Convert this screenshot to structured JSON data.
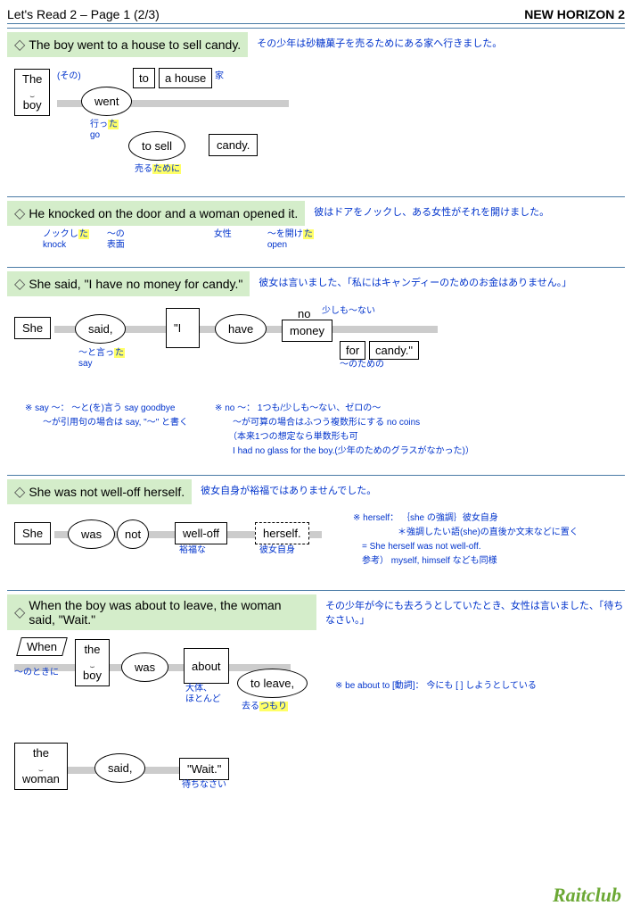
{
  "header": {
    "left": "Let's Read 2 – Page 1 (2/3)",
    "right": "NEW HORIZON 2"
  },
  "s1": {
    "en": "The boy went to a house to sell candy.",
    "jp": "その少年は砂糖菓子を売るためにある家へ行きました。",
    "w_the": "The",
    "w_boy": "boy",
    "w_went": "went",
    "w_to": "to",
    "w_house": "a house",
    "w_sell": "to sell",
    "w_candy": "candy.",
    "a_sono": "(その)",
    "a_ie": "家",
    "a_itta": "行った",
    "a_go": "go",
    "a_uru": "売るために"
  },
  "s2": {
    "en": "He knocked on the door and a woman opened it.",
    "jp": "彼はドアをノックし、ある女性がそれを開けました。",
    "a1a": "ノックした",
    "a1b": "knock",
    "a2a": "〜の",
    "a2b": "表面",
    "a3": "女性",
    "a4a": "〜を開けた",
    "a4b": "open"
  },
  "s3": {
    "en": "She said, \"I have no money for candy.\"",
    "jp": "彼女は言いました、「私にはキャンディーのためのお金はありません。」",
    "w_she": "She",
    "w_said": "said,",
    "w_i": "\"I",
    "w_have": "have",
    "w_no": "no",
    "w_money": "money",
    "w_for": "for",
    "w_candy": "candy.\"",
    "a_said1": "〜と言った",
    "a_said2": "say",
    "a_no": "少しも〜ない",
    "a_for": "〜のための",
    "n1a": "※ say 〜： 〜と(を)言う say goodbye",
    "n1b": "〜が引用句の場合は say, \"〜\" と書く",
    "n2a": "※ no 〜： 1つも/少しも〜ない、ゼロの〜",
    "n2b": "〜が可算の場合はふつう複数形にする no coins",
    "n2c": "（本来1つの想定なら単数形も可",
    "n2d": "I had no glass for the boy.(少年のためのグラスがなかった)）"
  },
  "s4": {
    "en": "She was not well-off herself.",
    "jp": "彼女自身が裕福ではありませんでした。",
    "w_she": "She",
    "w_was": "was",
    "w_not": "not",
    "w_well": "well-off",
    "w_her": "herself.",
    "a_yu": "裕福な",
    "a_her": "彼女自身",
    "n1": "※ herself： ｛she の強調｝彼女自身",
    "n2": "＊強調したい語(she)の直後か文末などに置く",
    "n3": "= She herself was not well-off.",
    "n4": "参考） myself, himself なども同様"
  },
  "s5": {
    "en": "When the boy was about to leave, the woman said, \"Wait.\"",
    "jp": "その少年が今にも去ろうとしていたとき、女性は言いました、「待ちなさい。」",
    "w_when": "When",
    "w_the": "the",
    "w_boy": "boy",
    "w_was": "was",
    "w_about": "about",
    "w_leave": "to leave,",
    "w_the2": "the",
    "w_woman": "woman",
    "w_said": "said,",
    "w_wait": "\"Wait.\"",
    "a_toki": "〜のときに",
    "a_dai": "大体、",
    "a_hoto": "ほとんど",
    "a_saru": "去るつもり",
    "a_machi": "待ちなさい",
    "n1": "※ be about to [動詞]： 今にも [ ] しようとしている"
  },
  "footer": "Raitclub"
}
